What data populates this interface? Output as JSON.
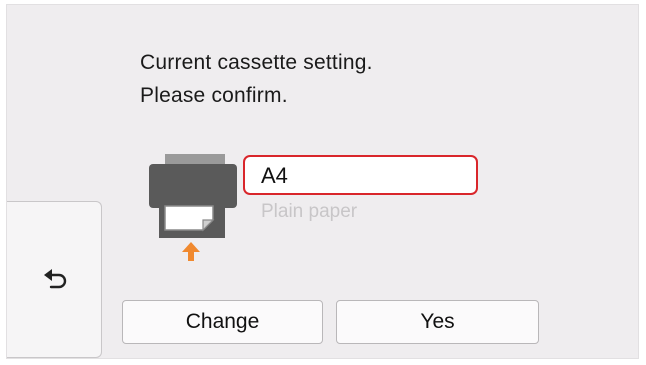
{
  "message": {
    "line1": "Current cassette setting.",
    "line2": "Please confirm."
  },
  "paper": {
    "size": "A4",
    "type": "Plain paper"
  },
  "buttons": {
    "change": "Change",
    "yes": "Yes"
  },
  "icons": {
    "back": "back-arrow-icon",
    "printer": "printer-cassette-icon",
    "feed": "paper-feed-up-arrow-icon"
  },
  "colors": {
    "screen_bg": "#efedef",
    "highlight": "#d9262b",
    "feed_arrow": "#f0892f",
    "printer_body": "#5a5a5a",
    "dimmed_text": "#c8c6c8"
  }
}
